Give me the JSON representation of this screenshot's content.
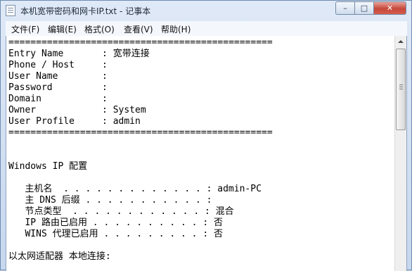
{
  "window": {
    "title": "本机宽带密码和网卡IP.txt - 记事本"
  },
  "titlebar_buttons": {
    "minimize": "–",
    "maximize": "□",
    "close": "✕"
  },
  "menu": [
    "文件(F)",
    "编辑(E)",
    "格式(O)",
    "查看(V)",
    "帮助(H)"
  ],
  "document": {
    "lines": [
      "================================================",
      "Entry Name       : 宽带连接",
      "Phone / Host     :",
      "User Name        :",
      "Password         :",
      "Domain           :",
      "Owner            : System",
      "User Profile     : admin",
      "================================================",
      "",
      "",
      "Windows IP 配置",
      "",
      "   主机名  . . . . . . . . . . . . . : admin-PC",
      "   主 DNS 后缀 . . . . . . . . . . . :",
      "   节点类型  . . . . . . . . . . . . : 混合",
      "   IP 路由已启用 . . . . . . . . . . : 否",
      "   WINS 代理已启用 . . . . . . . . . : 否",
      "",
      "以太网适配器 本地连接:"
    ]
  }
}
